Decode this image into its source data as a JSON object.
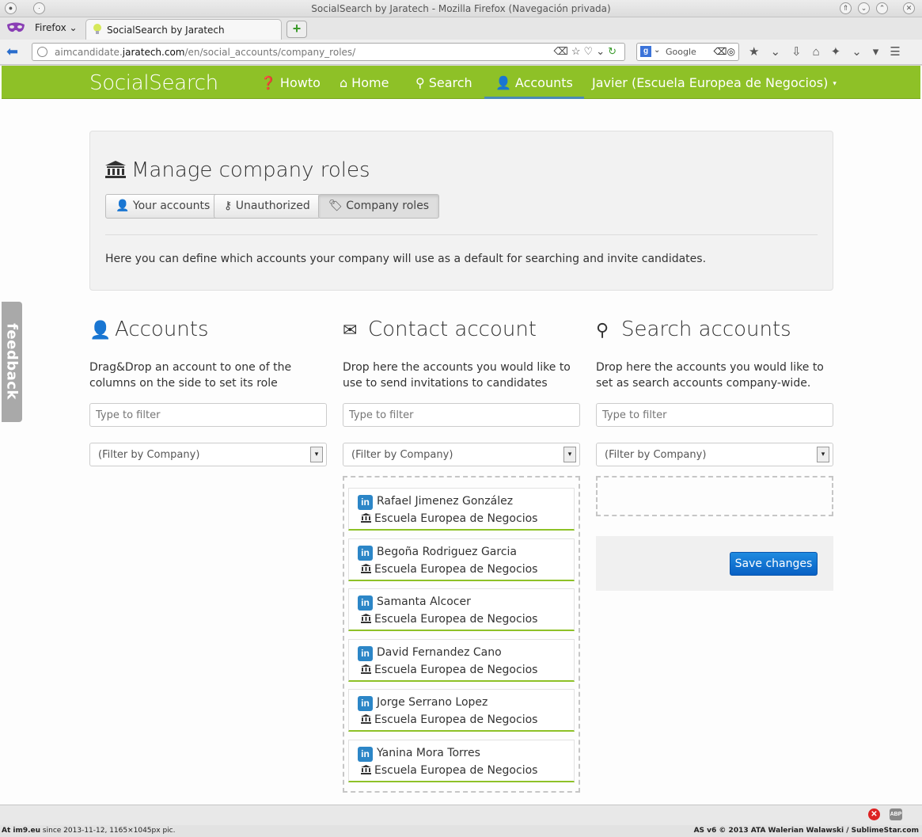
{
  "window": {
    "title": "SocialSearch by Jaratech - Mozilla Firefox (Navegación privada)",
    "firefox_menu": "Firefox",
    "tab_title": "SocialSearch by Jaratech",
    "url_prefix": "aimcandidate.",
    "url_domain": "jaratech.com",
    "url_path": "/en/social_accounts/company_roles/",
    "search_engine": "Google"
  },
  "app": {
    "brand": "SocialSearch",
    "nav": [
      {
        "label": "Howto",
        "icon": "question-circle-icon"
      },
      {
        "label": "Home",
        "icon": "home-icon"
      },
      {
        "label": "Search",
        "icon": "search-icon"
      },
      {
        "label": "Accounts",
        "icon": "user-icon",
        "active": true
      },
      {
        "label": "Javier (Escuela Europea de Negocios)",
        "icon": "caret-down-icon"
      }
    ]
  },
  "panel": {
    "title": "Manage company roles",
    "tabs": [
      {
        "label": "Your accounts",
        "icon": "user-icon"
      },
      {
        "label": "Unauthorized",
        "icon": "keys-icon"
      },
      {
        "label": "Company roles",
        "icon": "tag-icon",
        "active": true
      }
    ],
    "description": "Here you can define which accounts your company will use as a default for searching and invite candidates."
  },
  "columns": {
    "accounts": {
      "title": "Accounts",
      "description": "Drag&Drop an account to one of the columns on the side to set its role",
      "filter_placeholder": "Type to filter",
      "company_filter": "(Filter by Company)"
    },
    "contact": {
      "title": "Contact account",
      "description": "Drop here the accounts you would like to use to send invitations to candidates",
      "filter_placeholder": "Type to filter",
      "company_filter": "(Filter by Company)",
      "cards": [
        {
          "name": "Rafael Jimenez González",
          "company": "Escuela Europea de Negocios"
        },
        {
          "name": "Begoña Rodriguez Garcia",
          "company": "Escuela Europea de Negocios"
        },
        {
          "name": "Samanta Alcocer",
          "company": "Escuela Europea de Negocios"
        },
        {
          "name": "David Fernandez Cano",
          "company": "Escuela Europea de Negocios"
        },
        {
          "name": "Jorge Serrano Lopez",
          "company": "Escuela Europea de Negocios"
        },
        {
          "name": "Yanina Mora Torres",
          "company": "Escuela Europea de Negocios"
        }
      ]
    },
    "search": {
      "title": "Search accounts",
      "description": "Drop here the accounts you would like to set as search accounts company-wide.",
      "filter_placeholder": "Type to filter",
      "company_filter": "(Filter by Company)",
      "save_label": "Save changes"
    }
  },
  "feedback_label": "feedback",
  "caption": {
    "left_bold": "At im9.eu",
    "left": " since 2013-11-12, 1165×1045px pic.",
    "right": "AS v6 © 2013 ATA Walerian Walawski / SublimeStar.com"
  },
  "colors": {
    "navbar": "#8ec127",
    "save_button": "#0a6bd0",
    "linkedin": "#2c86c7"
  }
}
